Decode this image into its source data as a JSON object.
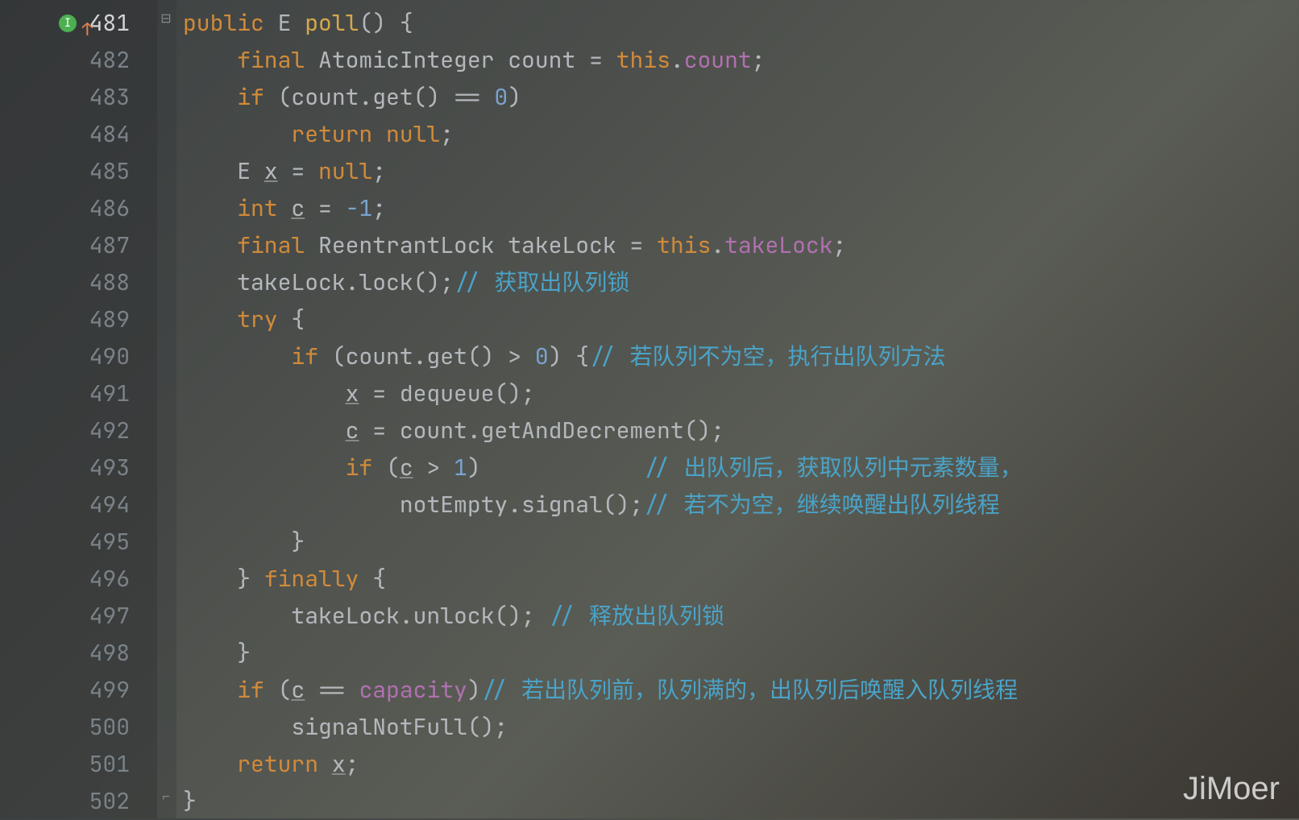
{
  "gutter": {
    "start": 481,
    "lines": [
      481,
      482,
      483,
      484,
      485,
      486,
      487,
      488,
      489,
      490,
      491,
      492,
      493,
      494,
      495,
      496,
      497,
      498,
      499,
      500,
      501,
      502
    ],
    "icon_label": "I"
  },
  "code": {
    "l481": {
      "kw1": "public",
      "type": "E",
      "method": "poll",
      "tail": "() {"
    },
    "l482": {
      "kw": "final",
      "type": "AtomicInteger",
      "name": "count",
      "eq": " = ",
      "kw2": "this",
      "dot": ".",
      "field": "count",
      "semi": ";"
    },
    "l483": {
      "kw": "if",
      "head": " (count.get() == ",
      "num": "0",
      "tail": ")"
    },
    "l484": {
      "kw": "return",
      "val": " null",
      "semi": ";"
    },
    "l485": {
      "type": "E ",
      "var": "x",
      "rest": " = ",
      "kw": "null",
      "semi": ";"
    },
    "l486": {
      "kw": "int ",
      "var": "c",
      "rest": " = ",
      "num": "-1",
      "semi": ";"
    },
    "l487": {
      "kw": "final",
      "type": " ReentrantLock ",
      "name": "takeLock = ",
      "kw2": "this",
      "dot": ".",
      "field": "takeLock",
      "semi": ";"
    },
    "l488": {
      "text": "takeLock.lock();",
      "comment": "// 获取出队列锁"
    },
    "l489": {
      "kw": "try",
      "tail": " {"
    },
    "l490": {
      "kw": "if",
      "head": " (count.get() > ",
      "num": "0",
      "tail": ") {",
      "comment": "// 若队列不为空，执行出队列方法"
    },
    "l491": {
      "var": "x",
      "rest": " = dequeue();"
    },
    "l492": {
      "var": "c",
      "rest": " = count.getAndDecrement();"
    },
    "l493": {
      "kw": "if",
      "head": " (",
      "var": "c",
      "mid": " > ",
      "num": "1",
      "tail": ")",
      "comment": "// 出队列后，获取队列中元素数量，"
    },
    "l494": {
      "text": "notEmpty.signal();",
      "comment": "// 若不为空，继续唤醒出队列线程"
    },
    "l495": {
      "text": "}"
    },
    "l496": {
      "text": "} ",
      "kw": "finally",
      "tail": " {"
    },
    "l497": {
      "text": "takeLock.unlock(); ",
      "comment": "// 释放出队列锁"
    },
    "l498": {
      "text": "}"
    },
    "l499": {
      "kw": "if",
      "head": " (",
      "var": "c",
      "mid": " == ",
      "field": "capacity",
      "tail": ")",
      "comment": "// 若出队列前，队列满的，出队列后唤醒入队列线程"
    },
    "l500": {
      "text": "signalNotFull();"
    },
    "l501": {
      "kw": "return ",
      "var": "x",
      "semi": ";"
    },
    "l502": {
      "text": "}"
    }
  },
  "watermark": "JiMoer"
}
